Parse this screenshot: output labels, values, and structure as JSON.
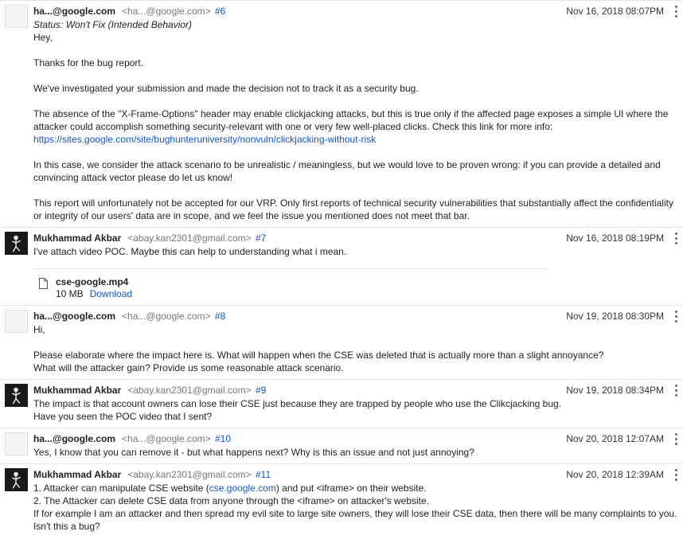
{
  "comments": [
    {
      "author": "ha...@google.com",
      "email": "<ha...@google.com>",
      "num": "#6",
      "date": "Nov 16, 2018 08:07PM",
      "status": "Status: Won't Fix (Intended Behavior)",
      "paragraphs": [
        "Hey,",
        "Thanks for the bug report.",
        "We've investigated your submission and made the decision not to track it as a security bug.",
        "The absence of the \"X-Frame-Options\" header may enable clickjacking attacks, but this is true only if the affected page exposes a simple UI where the attacker could accomplish something security-relevant with one or very few well-placed clicks. Check this link for more info:",
        "In this case, we consider the attack scenario to be unrealistic / meaningless, but we would love to be proven wrong: if you can provide a detailed and convincing attack vector please do let us know!",
        "This report will unfortunately not be accepted for our VRP. Only first reports of technical security vulnerabilities that substantially affect the confidentiality or integrity of our users' data are in scope, and we feel the issue you mentioned does not meet that bar."
      ],
      "link": "https://sites.google.com/site/bughunteruniversity/nonvuln/clickjacking-without-risk"
    },
    {
      "author": "Mukhammad Akbar",
      "email": "<abay.kan2301@gmail.com>",
      "num": "#7",
      "date": "Nov 16, 2018 08:19PM",
      "text": "I've attach video POC. Maybe this can help to understanding what i mean.",
      "attachment": {
        "name": "cse-google.mp4",
        "size": "10 MB",
        "download": "Download"
      }
    },
    {
      "author": "ha...@google.com",
      "email": "<ha...@google.com>",
      "num": "#8",
      "date": "Nov 19, 2018 08:30PM",
      "greeting": "Hi,",
      "line1": "Please elaborate where the impact here is. What will happen when the CSE was deleted that is actually more than a slight annoyance?",
      "line2": "What will the attacker gain? Provide us some reasonable attack scenario."
    },
    {
      "author": "Mukhammad Akbar",
      "email": "<abay.kan2301@gmail.com>",
      "num": "#9",
      "date": "Nov 19, 2018 08:34PM",
      "line1": "The impact is that account owners can lose their CSE just because they are trapped by people who use the Clikcjacking bug.",
      "line2": "Have you seen the POC video that I sent?"
    },
    {
      "author": "ha...@google.com",
      "email": "<ha...@google.com>",
      "num": "#10",
      "date": "Nov 20, 2018 12:07AM",
      "text": "Yes, I know that you can remove it - but what happens next? Why is this an issue and not just annoying?"
    },
    {
      "author": "Mukhammad Akbar",
      "email": "<abay.kan2301@gmail.com>",
      "num": "#11",
      "date": "Nov 20, 2018 12:39AM",
      "l1_pre": "1. Attacker can manipulate CSE website (",
      "l1_link": "cse.google.com",
      "l1_post": ") and put <iframe> on their website.",
      "l2": "2. The Attacker can delete CSE data from anyone through the <iframe> on attacker's website.",
      "l3": "If for example I am an attacker and then spread my evil site to large site owners, they will lose their CSE data, then there will be many complaints to you. Isn't this a bug?"
    }
  ]
}
